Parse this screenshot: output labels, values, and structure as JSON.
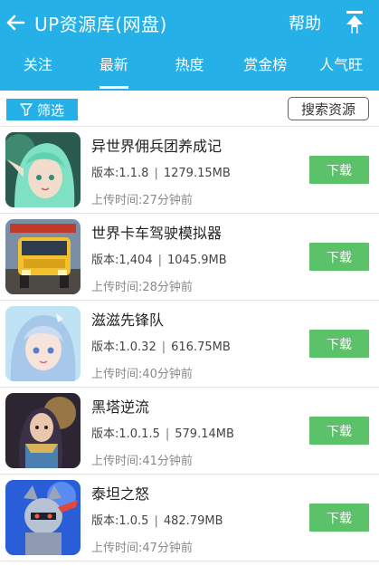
{
  "header": {
    "title": "UP资源库(网盘)",
    "help_label": "帮助",
    "background": "#26b0e8"
  },
  "tabs": [
    {
      "label": "关注",
      "active": false
    },
    {
      "label": "最新",
      "active": true
    },
    {
      "label": "热度",
      "active": false
    },
    {
      "label": "赏金榜",
      "active": false
    },
    {
      "label": "人气旺",
      "active": false
    }
  ],
  "filterbar": {
    "filter_label": "筛选",
    "search_label": "搜索资源"
  },
  "items": [
    {
      "name": "异世界佣兵团养成记",
      "version": "版本:1.1.8",
      "size": "1279.15MB",
      "time": "上传时间:27分钟前",
      "button": "下载",
      "icon": "anime-elf-icon"
    },
    {
      "name": "世界卡车驾驶模拟器",
      "version": "版本:1,404",
      "size": "1045.9MB",
      "time": "上传时间:28分钟前",
      "button": "下载",
      "icon": "truck-icon"
    },
    {
      "name": "滋滋先锋队",
      "version": "版本:1.0.32",
      "size": "616.75MB",
      "time": "上传时间:40分钟前",
      "button": "下载",
      "icon": "anime-girl-icon"
    },
    {
      "name": "黑塔逆流",
      "version": "版本:1.0.1.5",
      "size": "579.14MB",
      "time": "上传时间:41分钟前",
      "button": "下载",
      "icon": "dark-heroine-icon"
    },
    {
      "name": "泰坦之怒",
      "version": "版本:1.0.5",
      "size": "482.79MB",
      "time": "上传时间:47分钟前",
      "button": "下载",
      "icon": "armored-knight-icon"
    }
  ],
  "colors": {
    "accent": "#26b0e8",
    "download": "#5bc26a"
  }
}
